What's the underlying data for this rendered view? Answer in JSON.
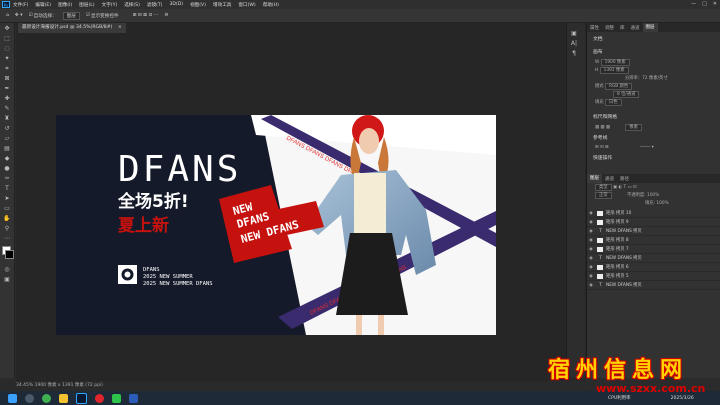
{
  "menu": [
    "文件(F)",
    "编辑(E)",
    "图像(I)",
    "图层(L)",
    "文字(Y)",
    "选择(S)",
    "滤镜(T)",
    "3D(D)",
    "视图(V)",
    "增效工具",
    "窗口(W)",
    "帮助(H)"
  ],
  "options": {
    "auto_select": "自动选择：",
    "group": "图层",
    "transform": "显示变换控件"
  },
  "doc_tab": "最新设计海报设计.psd @ 34.5%(RGB/8#)",
  "canvas": {
    "brand": "DFANS",
    "sale": "全场5折!",
    "new_arrival": "夏上新",
    "tag_lines": [
      "NEW",
      "DFANS",
      "NEW DFANS"
    ],
    "footer": [
      "DFANS",
      "2025 NEW SUMMER",
      "2025 NEW SUMMER DFANS"
    ],
    "ribbon_text": "DFANS DFANS DFANS DFANS DFANS"
  },
  "panel": {
    "tabs": [
      "属性",
      "调整",
      "库",
      "通道",
      "图层"
    ],
    "doc_label": "文档",
    "canvas_section": "画布",
    "w_label": "W",
    "w_value": "1900 像素",
    "h_label": "H",
    "h_value": "1391 像素",
    "resolution": "分辨率：72 像素/英寸",
    "mode_label": "模式",
    "mode_value": "RGB 颜色",
    "depth_value": "8 位/通道",
    "fill_label": "填充",
    "fill_value": "白色",
    "grid_section": "标尺和网格",
    "grid_unit": "像素",
    "guides_section": "参考线",
    "quick_section": "快速操作",
    "layers_tabs": [
      "图层",
      "通道",
      "路径"
    ],
    "kind": "类型",
    "normal": "正常",
    "opacity": "不透明度: 100%",
    "fill": "填充: 100%",
    "layers": [
      "矩形 拷贝 10",
      "矩形 拷贝 9",
      "NEW DFANS 拷贝",
      "矩形 拷贝 8",
      "矩形 拷贝 7",
      "NEW DFANS 拷贝",
      "矩形 拷贝 6",
      "矩形 拷贝 5",
      "NEW DFANS 拷贝"
    ]
  },
  "status": "34.45%   1900 像素 x 1391 像素 (72 ppi)",
  "taskbar": {
    "time": "2025/3/26",
    "cpu": "CPU利用率"
  },
  "watermark": {
    "title": "宿州信息网",
    "url": "www.szxx.com.cn"
  },
  "colors": {
    "accent": "#d0100c",
    "canvas_dark": "#151a2a",
    "ribbon": "#3a2a6e"
  }
}
